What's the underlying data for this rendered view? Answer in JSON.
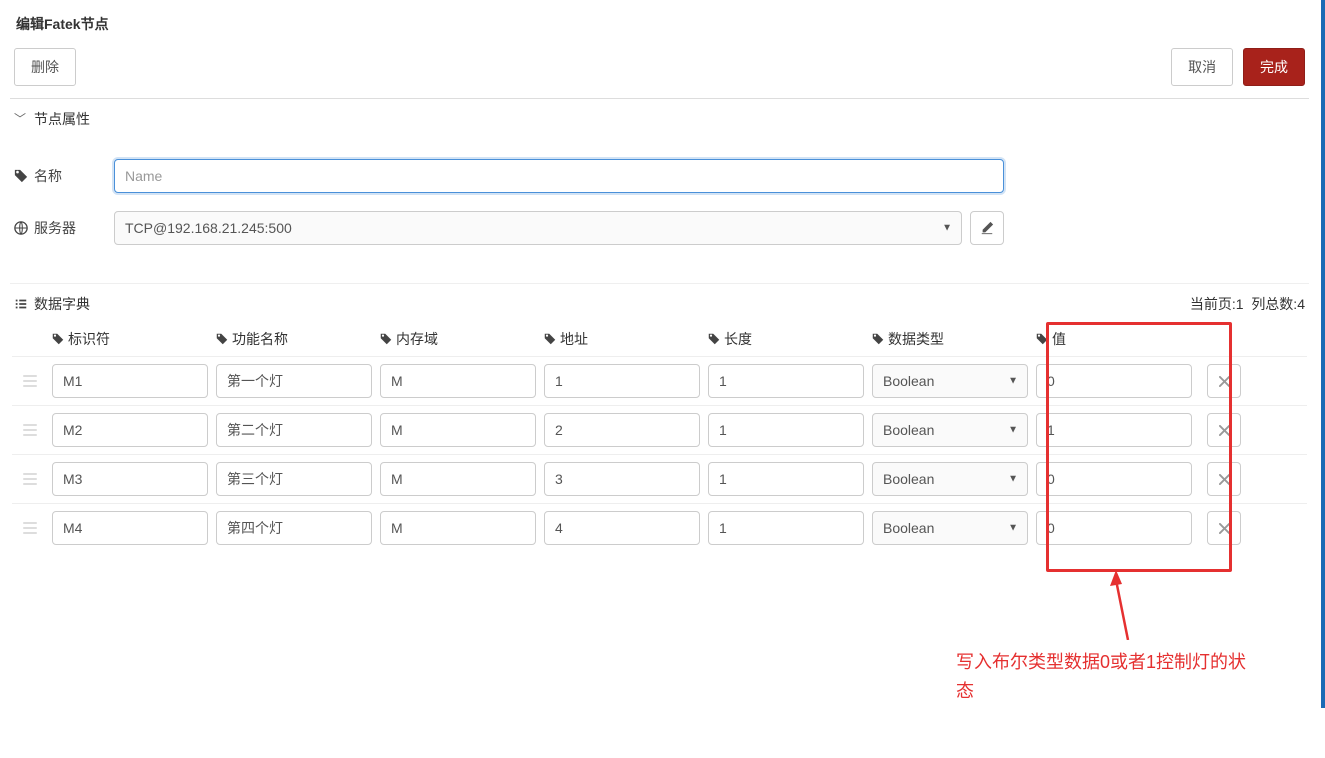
{
  "dialog": {
    "title": "编辑Fatek节点"
  },
  "toolbar": {
    "delete": "删除",
    "cancel": "取消",
    "finish": "完成"
  },
  "section": {
    "title": "节点属性"
  },
  "form": {
    "name_label": "名称",
    "name_placeholder": "Name",
    "name_value": "",
    "server_label": "服务器",
    "server_value": "TCP@192.168.21.245:500"
  },
  "dict": {
    "title": "数据字典",
    "page_label": "当前页:",
    "page_value": "1",
    "total_label": "列总数:",
    "total_value": "4",
    "columns": {
      "identifier": "标识符",
      "func": "功能名称",
      "memory": "内存域",
      "addr": "地址",
      "len": "长度",
      "type": "数据类型",
      "value": "值"
    },
    "rows": [
      {
        "identifier": "M1",
        "func": "第一个灯",
        "memory": "M",
        "addr": "1",
        "len": "1",
        "type": "Boolean",
        "value": "0"
      },
      {
        "identifier": "M2",
        "func": "第二个灯",
        "memory": "M",
        "addr": "2",
        "len": "1",
        "type": "Boolean",
        "value": "1"
      },
      {
        "identifier": "M3",
        "func": "第三个灯",
        "memory": "M",
        "addr": "3",
        "len": "1",
        "type": "Boolean",
        "value": "0"
      },
      {
        "identifier": "M4",
        "func": "第四个灯",
        "memory": "M",
        "addr": "4",
        "len": "1",
        "type": "Boolean",
        "value": "0"
      }
    ]
  },
  "annotation": {
    "text": "写入布尔类型数据0或者1控制灯的状态"
  },
  "icons": {
    "tag": "tag-icon",
    "globe": "globe-icon",
    "list": "list-icon",
    "pencil": "pencil-icon",
    "close": "close-icon"
  }
}
